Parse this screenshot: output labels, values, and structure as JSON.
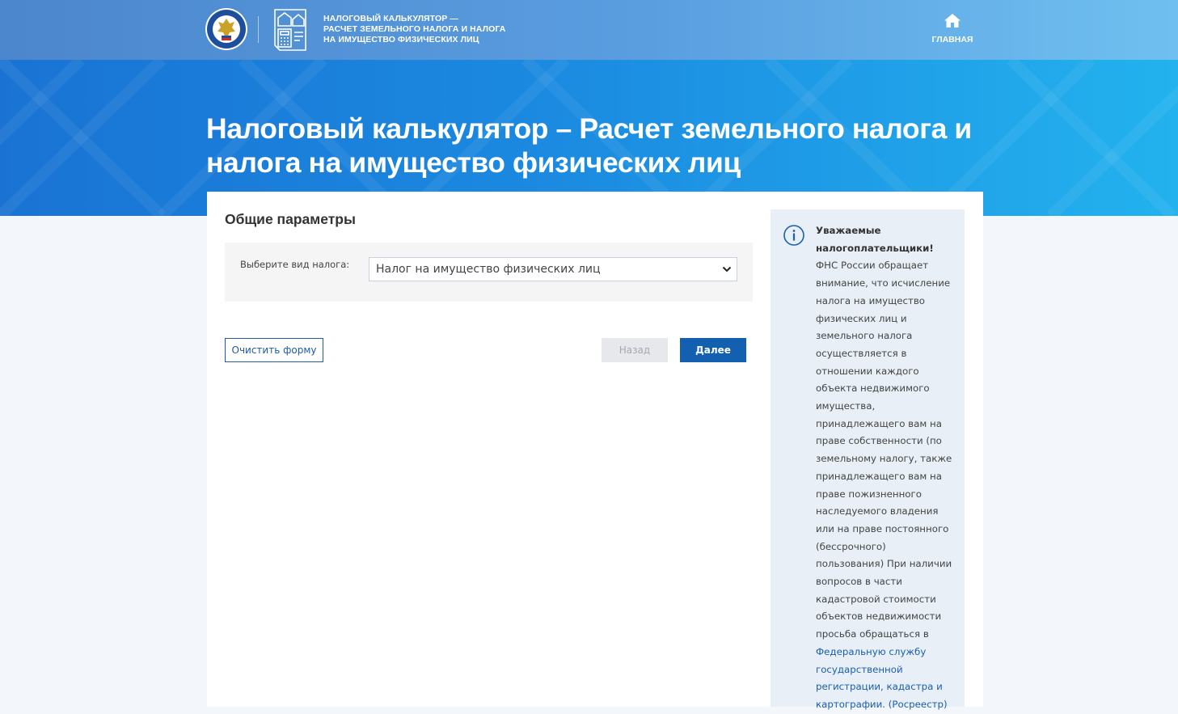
{
  "header": {
    "app_title_lines": [
      "НАЛОГОВЫЙ КАЛЬКУЛЯТОР —",
      "РАСЧЕТ ЗЕМЕЛЬНОГО НАЛОГА И НАЛОГА",
      "НА ИМУЩЕСТВО ФИЗИЧЕСКИХ ЛИЦ"
    ],
    "nav_home_label": "ГЛАВНАЯ",
    "nav_home_icon": "home-icon",
    "logo_icon": "fns-emblem-icon",
    "calculator_icon": "calculator-icon"
  },
  "hero": {
    "title_line1": "Налоговый калькулятор – Расчет земельного налога и",
    "title_line2": "налога на имущество физических лиц"
  },
  "form": {
    "section_title": "Общие параметры",
    "tax_type_label": "Выберите вид налога:",
    "tax_type_value": "Налог на имущество физических лиц",
    "clear_button": "Очистить форму",
    "back_button": "Назад",
    "next_button": "Далее"
  },
  "info": {
    "icon": "info-icon",
    "heading": "Уважаемые налогоплательщики!",
    "body": "ФНС России обращает внимание, что исчисление налога на имущество физических лиц и земельного налога осуществляется в отношении каждого объекта недвижимого имущества, принадлежащего вам на праве собственности (по земельному налогу, также принадлежащего вам на праве пожизненного наследуемого владения или на праве постоянного (бессрочного) пользования) При наличии вопросов в части кадастровой стоимости объектов недвижимости просьба обращаться в",
    "link": "Федеральную службу государственной регистрации, кадастра и картографии. (Росреестр)"
  },
  "colors": {
    "header_blue": "#4c86cd",
    "hero_blue": "#1b89e0",
    "primary_button": "#1460b0",
    "link": "#1a5fae",
    "info_bg": "#e8eff6"
  }
}
